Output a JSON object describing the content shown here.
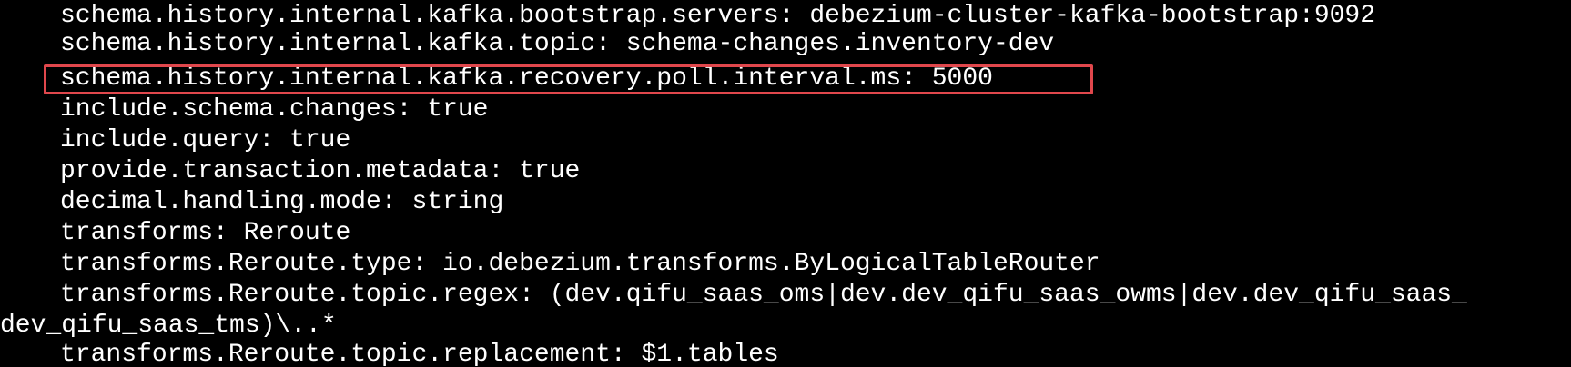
{
  "terminal": {
    "lines": [
      "schema.history.internal.kafka.bootstrap.servers: debezium-cluster-kafka-bootstrap:9092",
      "schema.history.internal.kafka.topic: schema-changes.inventory-dev",
      "schema.history.internal.kafka.recovery.poll.interval.ms: 5000",
      "include.schema.changes: true",
      "include.query: true",
      "provide.transaction.metadata: true",
      "decimal.handling.mode: string",
      "transforms: Reroute",
      "transforms.Reroute.type: io.debezium.transforms.ByLogicalTableRouter",
      "transforms.Reroute.topic.regex: (dev.qifu_saas_oms|dev.dev_qifu_saas_owms|dev.dev_qifu_saas_",
      "dev_qifu_saas_tms)\\..*",
      "transforms.Reroute.topic.replacement: $1.tables"
    ],
    "highlight_color": "#e0474c",
    "text_color": "#ffffff",
    "background_color": "#000000"
  }
}
